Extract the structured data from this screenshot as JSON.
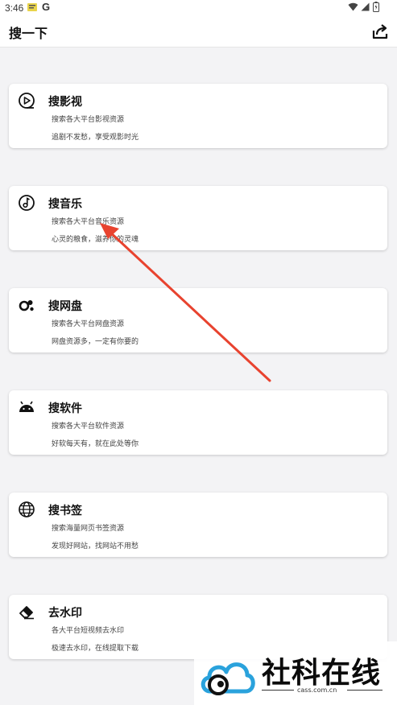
{
  "status_bar": {
    "time": "3:46",
    "icons": [
      "notification-icon",
      "google-icon",
      "wifi-icon",
      "signal-icon",
      "battery-icon"
    ]
  },
  "app_bar": {
    "title": "搜一下",
    "share_icon": "share-icon"
  },
  "cards": [
    {
      "title": "搜影视",
      "desc1": "搜索各大平台影视资源",
      "desc2": "追剧不发愁，享受观影时光",
      "icon": "play-circle-icon"
    },
    {
      "title": "搜音乐",
      "desc1": "搜索各大平台音乐资源",
      "desc2": "心灵的粮食，滋养你的灵魂",
      "icon": "music-note-icon"
    },
    {
      "title": "搜网盘",
      "desc1": "搜索各大平台网盘资源",
      "desc2": "网盘资源多，一定有你要的",
      "icon": "cloud-link-icon"
    },
    {
      "title": "搜软件",
      "desc1": "搜索各大平台软件资源",
      "desc2": "好软每天有，就在此处等你",
      "icon": "android-icon"
    },
    {
      "title": "搜书签",
      "desc1": "搜索海量网页书签资源",
      "desc2": "发现好网站，找网站不用愁",
      "icon": "globe-icon"
    },
    {
      "title": "去水印",
      "desc1": "各大平台短视频去水印",
      "desc2": "极速去水印，在线提取下载",
      "icon": "eraser-icon"
    }
  ],
  "colors": {
    "background": "#f3f3f5",
    "card": "#ffffff",
    "annotation_arrow": "#e8432f"
  },
  "watermark": {
    "text": "社科在线",
    "url": "cass.com.cn"
  }
}
